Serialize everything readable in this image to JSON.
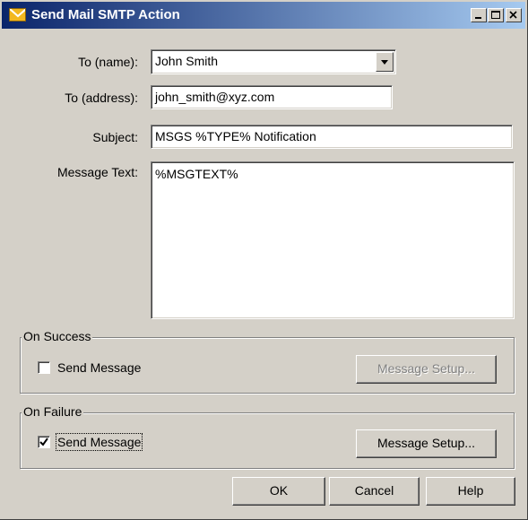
{
  "window": {
    "title": "Send Mail SMTP Action",
    "icon": "mail-envelope-icon",
    "caption_buttons": [
      "minimize",
      "maximize",
      "close"
    ]
  },
  "form": {
    "to_name": {
      "label": "To (name):",
      "value": "John Smith"
    },
    "to_address": {
      "label": "To (address):",
      "value": "john_smith@xyz.com"
    },
    "subject": {
      "label": "Subject:",
      "value": "MSGS %TYPE% Notification"
    },
    "message_text": {
      "label": "Message Text:",
      "value": "%MSGTEXT%"
    }
  },
  "on_success": {
    "title": "On Success",
    "send_message_label": "Send Message",
    "send_message_checked": false,
    "message_setup_label": "Message Setup...",
    "message_setup_enabled": false
  },
  "on_failure": {
    "title": "On Failure",
    "send_message_label": "Send Message",
    "send_message_checked": true,
    "message_setup_label": "Message Setup...",
    "message_setup_enabled": true
  },
  "buttons": {
    "ok": "OK",
    "cancel": "Cancel",
    "help": "Help"
  }
}
